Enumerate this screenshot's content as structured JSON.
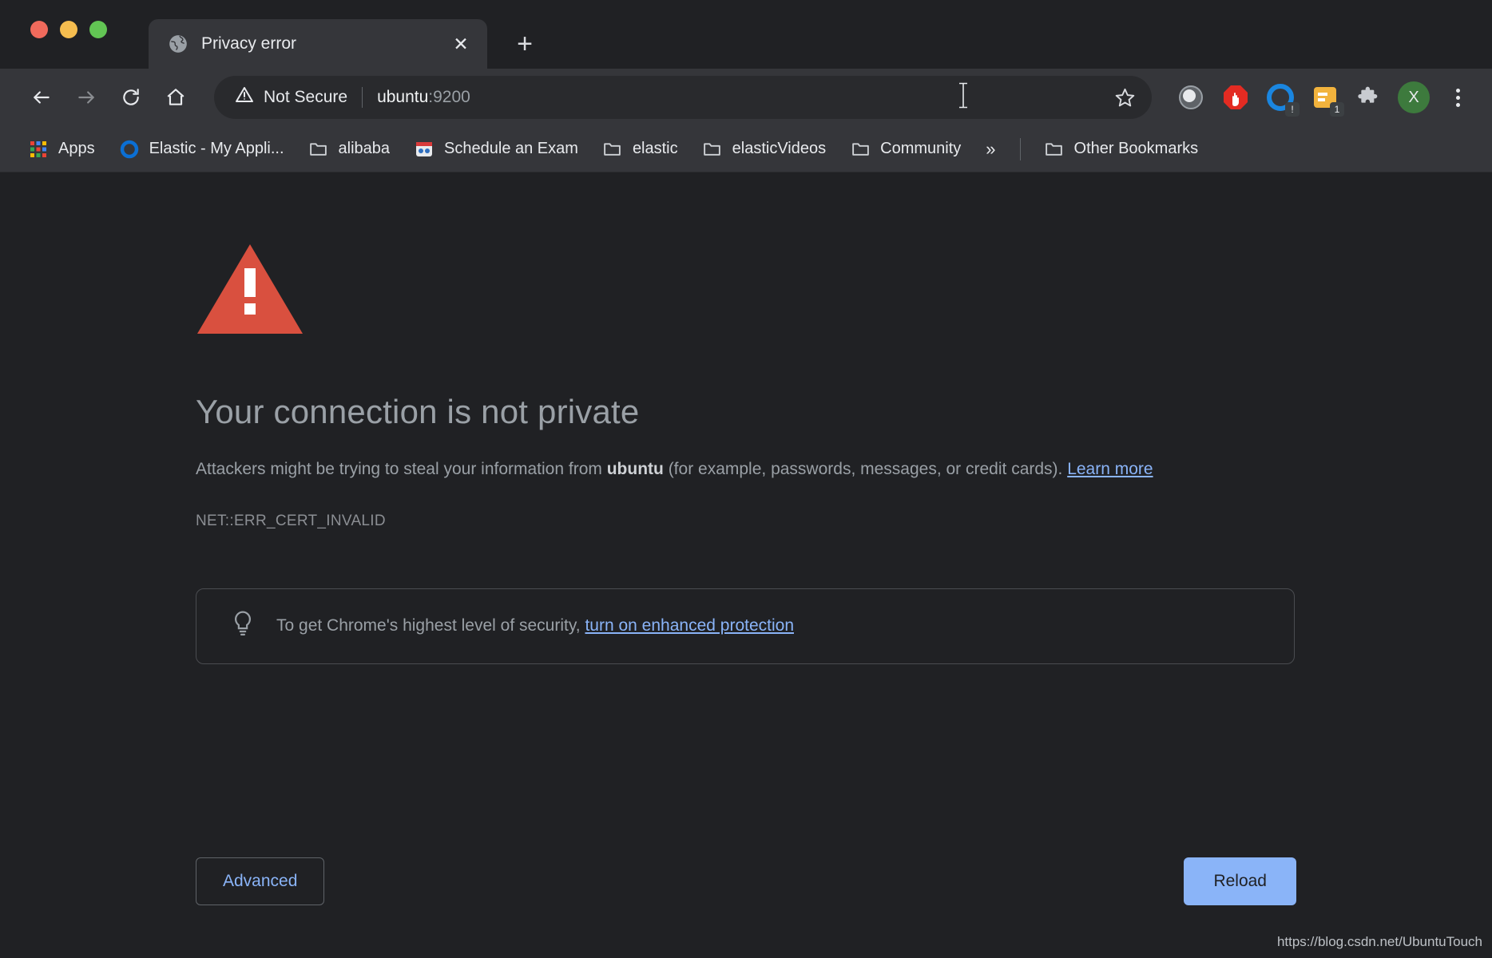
{
  "window": {
    "traffic_lights": [
      "close",
      "minimize",
      "maximize"
    ]
  },
  "tab": {
    "title": "Privacy error",
    "favicon": "globe-icon",
    "close_label": "✕",
    "new_tab_label": "+"
  },
  "toolbar": {
    "back_label": "←",
    "forward_label": "→",
    "reload_label": "⟳",
    "home_label": "⌂",
    "security_label": "Not Secure",
    "url_host": "ubuntu",
    "url_port": ":9200",
    "star_label": "☆",
    "extensions": [
      {
        "name": "grey-circle-extension-icon",
        "badge": ""
      },
      {
        "name": "adblock-stop-hand-icon",
        "badge": ""
      },
      {
        "name": "blue-circle-extension-icon",
        "badge": "!"
      },
      {
        "name": "yellow-note-extension-icon",
        "badge": "1"
      },
      {
        "name": "puzzle-extensions-icon",
        "badge": ""
      }
    ],
    "avatar_initial": "X",
    "menu_label": "⋮"
  },
  "bookmarks": {
    "items": [
      {
        "label": "Apps",
        "icon": "apps-grid-icon"
      },
      {
        "label": "Elastic - My Appli...",
        "icon": "elastic-circle-icon"
      },
      {
        "label": "alibaba",
        "icon": "folder-icon"
      },
      {
        "label": "Schedule an Exam",
        "icon": "exam-icon"
      },
      {
        "label": "elastic",
        "icon": "folder-icon"
      },
      {
        "label": "elasticVideos",
        "icon": "folder-icon"
      },
      {
        "label": "Community",
        "icon": "folder-icon"
      }
    ],
    "overflow_label": "»",
    "other_bookmarks": {
      "label": "Other Bookmarks",
      "icon": "folder-icon"
    }
  },
  "error_page": {
    "icon": "red-warning-triangle-icon",
    "title": "Your connection is not private",
    "body_prefix": "Attackers might be trying to steal your information from ",
    "body_host": "ubuntu",
    "body_suffix": " (for example, passwords, messages, or credit cards). ",
    "learn_more": "Learn more",
    "error_code": "NET::ERR_CERT_INVALID",
    "callout": {
      "icon": "lightbulb-icon",
      "text": "To get Chrome's highest level of security, ",
      "link": "turn on enhanced protection"
    },
    "advanced_label": "Advanced",
    "reload_label": "Reload"
  },
  "status_bar": {
    "text": "https://blog.csdn.net/UbuntuTouch"
  },
  "colors": {
    "accent_link": "#8ab4f8",
    "warning_red": "#d9503f",
    "toolbar_bg": "#35363a",
    "page_bg": "#202124"
  }
}
